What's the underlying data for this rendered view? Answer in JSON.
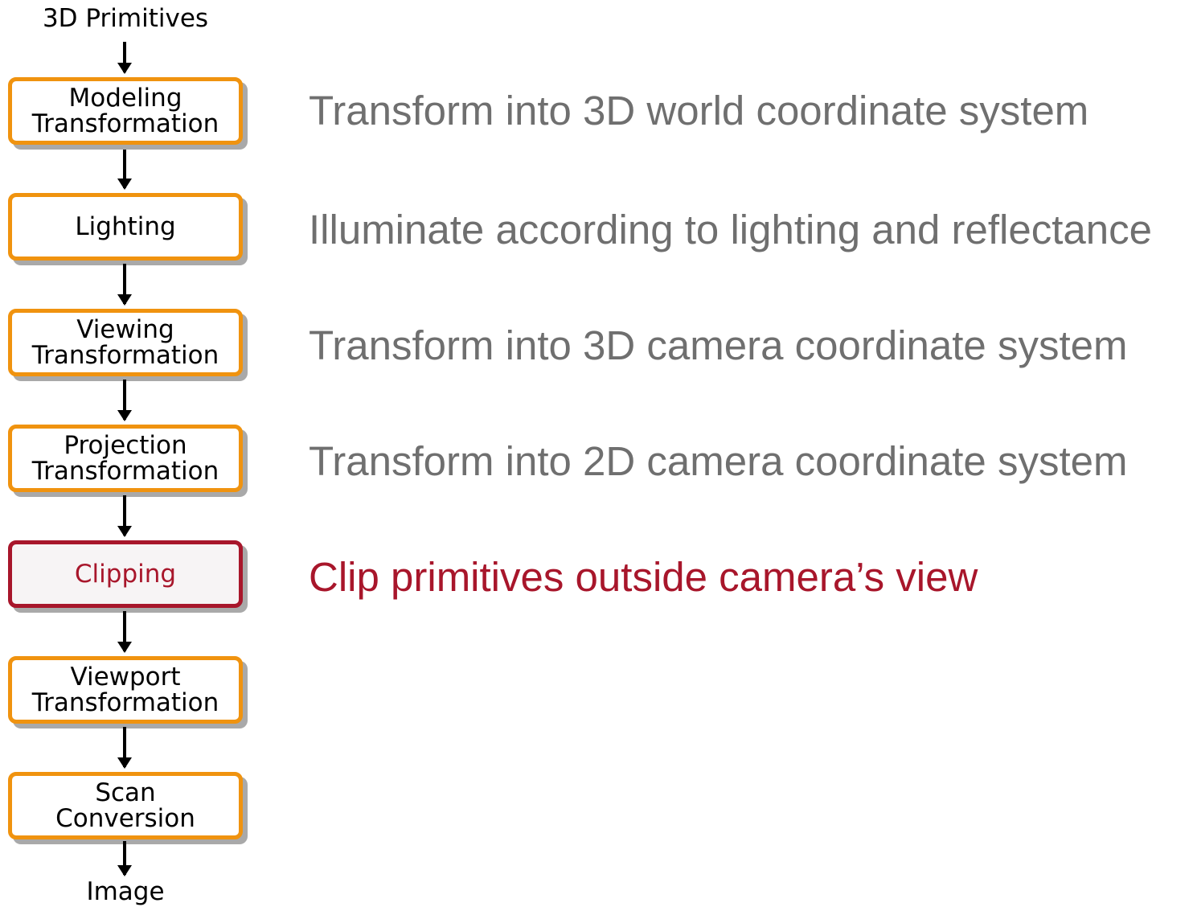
{
  "pipeline": {
    "input_label": "3D Primitives",
    "output_label": "Image",
    "stages": [
      {
        "label": "Modeling\nTransformation",
        "description": "Transform into 3D world coordinate system"
      },
      {
        "label": "Lighting",
        "description": "Illuminate according to lighting and reflectance"
      },
      {
        "label": "Viewing\nTransformation",
        "description": "Transform into 3D camera coordinate system"
      },
      {
        "label": "Projection\nTransformation",
        "description": "Transform into 2D camera coordinate system"
      },
      {
        "label": "Clipping",
        "description": "Clip primitives outside camera’s view",
        "highlighted": true
      },
      {
        "label": "Viewport\nTransformation"
      },
      {
        "label": "Scan\nConversion"
      }
    ]
  },
  "colors": {
    "stage_border": "#f0930f",
    "highlight": "#a8162b",
    "description_text": "#6f6f6f",
    "shadow": "#a9a9a9"
  }
}
